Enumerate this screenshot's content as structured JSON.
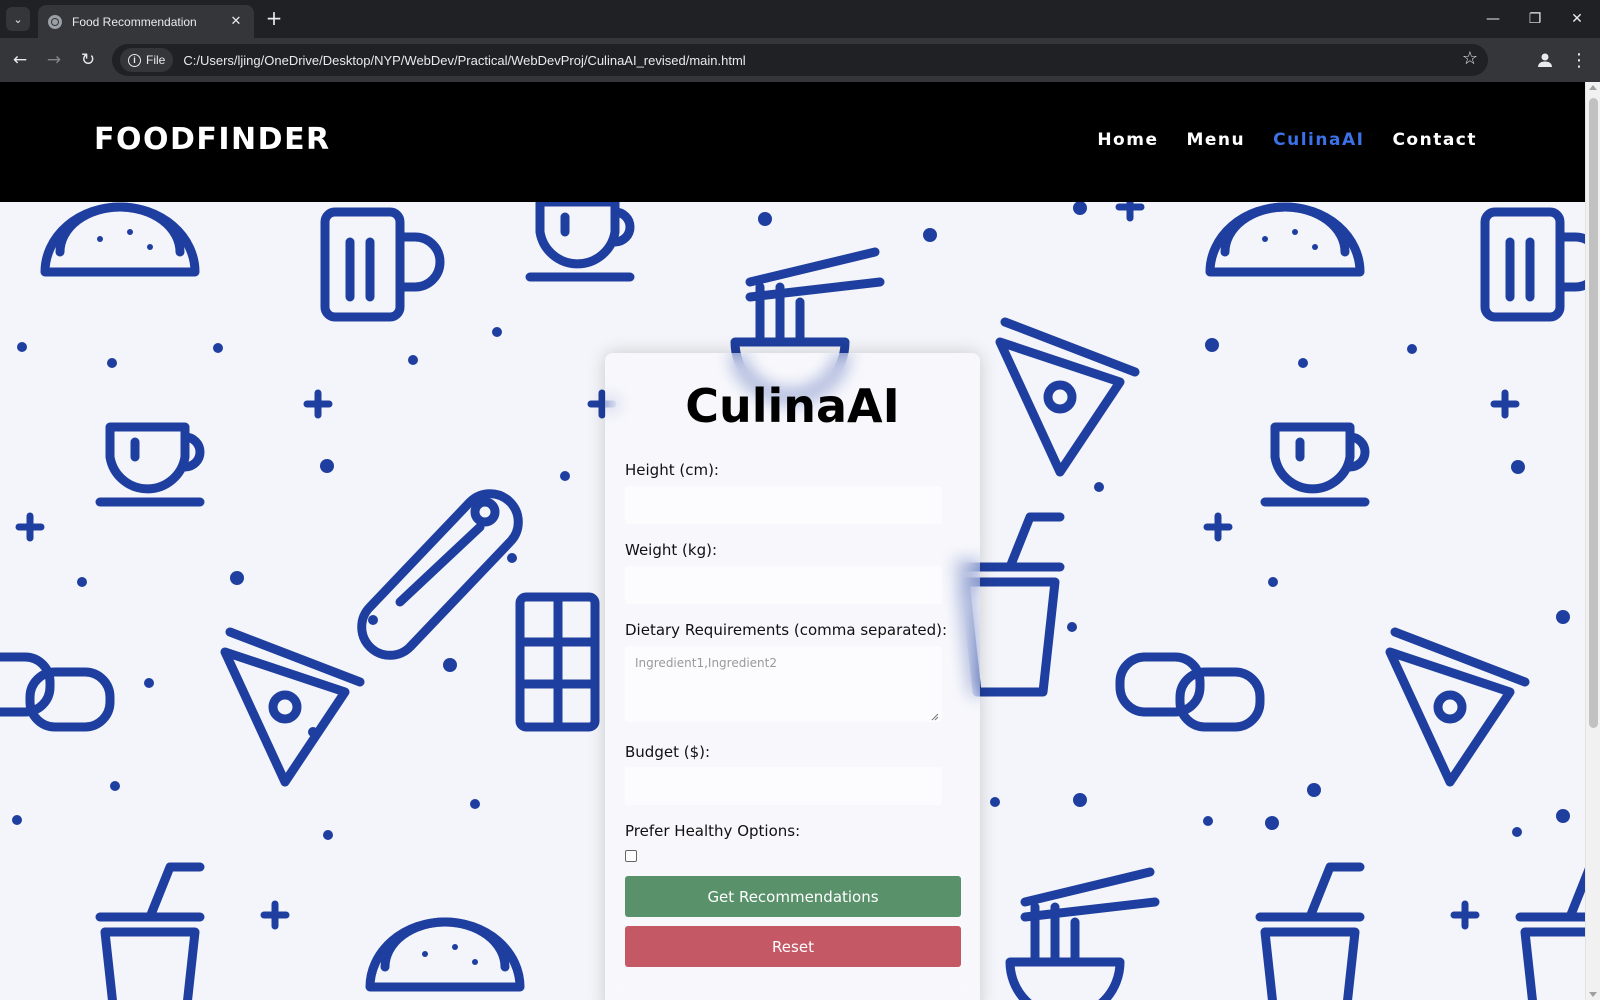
{
  "browser": {
    "tab_title": "Food Recommendation",
    "close_glyph": "✕",
    "newtab_glyph": "+",
    "url_chip": "File",
    "url": "C:/Users/ljing/OneDrive/Desktop/NYP/WebDev/Practical/WebDevProj/CulinaAI_revised/main.html",
    "back_glyph": "←",
    "forward_glyph": "→",
    "reload_glyph": "↻",
    "star_glyph": "☆",
    "menu_glyph": "⋮",
    "tabsearch_glyph": "⌄",
    "win_min": "—",
    "win_restore": "❐",
    "win_close": "✕"
  },
  "site": {
    "logo": "FOODFINDER",
    "nav": [
      {
        "label": "Home",
        "active": false
      },
      {
        "label": "Menu",
        "active": false
      },
      {
        "label": "CulinaAI",
        "active": true
      },
      {
        "label": "Contact",
        "active": false
      }
    ],
    "accent_color": "#3b72e8",
    "pattern_color": "#1f3fa0"
  },
  "form": {
    "title": "CulinaAI",
    "height_label": "Height (cm):",
    "height_value": "",
    "weight_label": "Weight (kg):",
    "weight_value": "",
    "dietary_label": "Dietary Requirements (comma separated):",
    "dietary_placeholder": "Ingredient1,Ingredient2",
    "budget_label": "Budget ($):",
    "budget_value": "",
    "healthy_label": "Prefer Healthy Options:",
    "healthy_checked": false,
    "submit_label": "Get Recommendations",
    "reset_label": "Reset",
    "submit_color": "#58916a",
    "reset_color": "#c55865"
  }
}
